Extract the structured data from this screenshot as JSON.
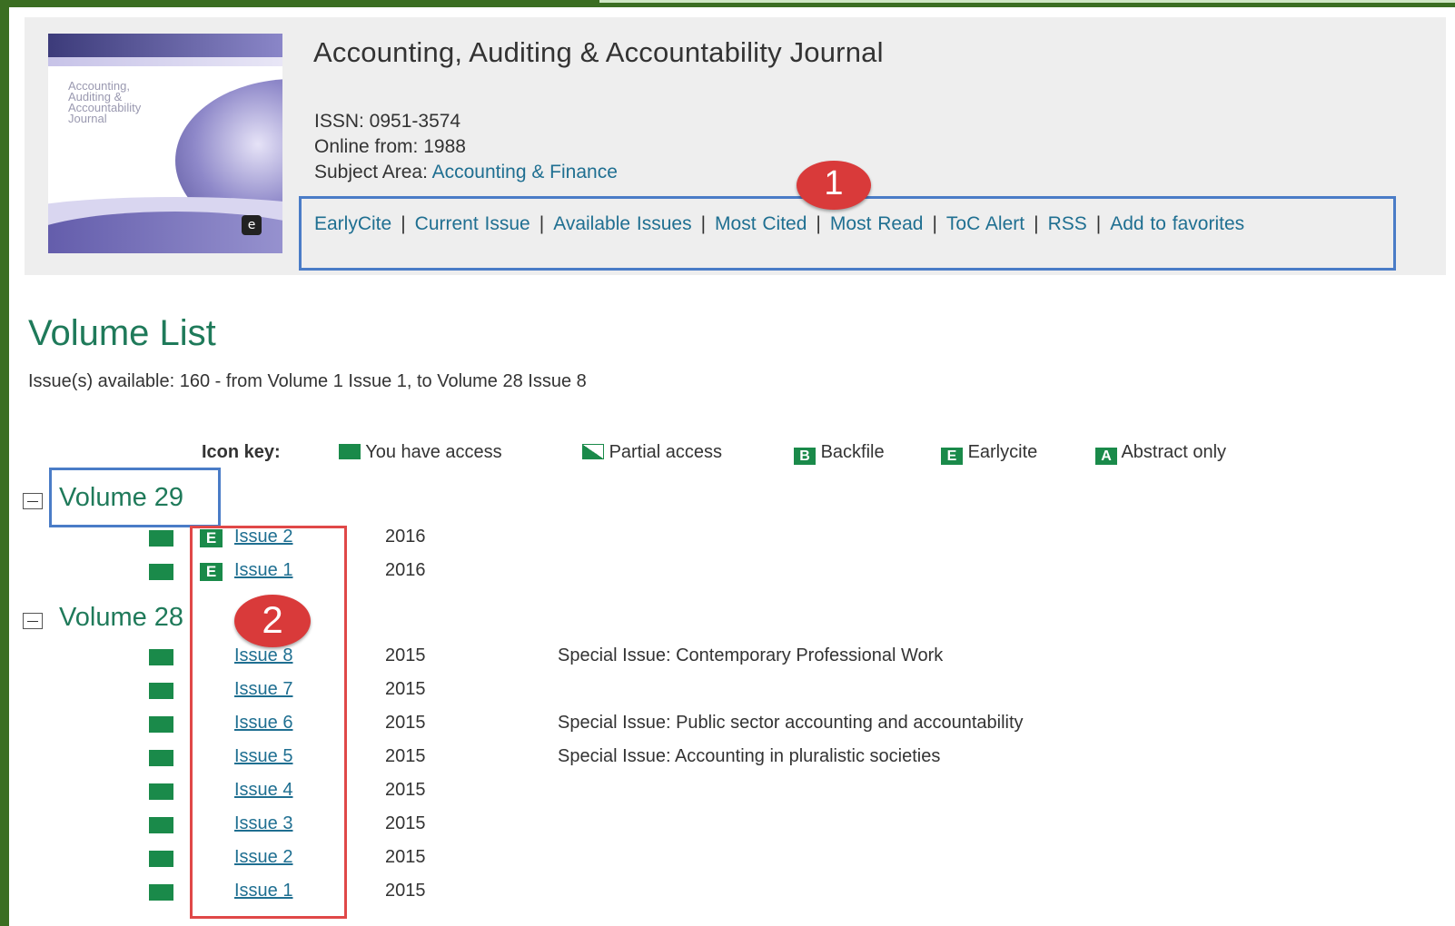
{
  "journal": {
    "title": "Accounting, Auditing & Accountability Journal",
    "issn": "ISSN: 0951-3574",
    "online_from": "Online from: 1988",
    "subject_prefix": "Subject Area: ",
    "subject_link": "Accounting & Finance",
    "cover_text": "Accounting, Auditing & Accountability Journal"
  },
  "nav": {
    "items": [
      "EarlyCite",
      "Current Issue",
      "Available Issues",
      "Most Cited",
      "Most Read",
      "ToC Alert",
      "RSS",
      "Add to favorites"
    ],
    "separator": "|"
  },
  "annotations": {
    "badge1": "1",
    "badge2": "2"
  },
  "volume_list": {
    "title": "Volume List",
    "available": "Issue(s) available: 160 - from Volume 1 Issue 1, to Volume 28 Issue 8"
  },
  "icon_key": {
    "label": "Icon key:",
    "items": [
      "You have access",
      "Partial access",
      "Backfile",
      "Earlycite",
      "Abstract only"
    ],
    "letters": {
      "backfile": "B",
      "earlycite": "E",
      "abstract": "A"
    }
  },
  "volumes": [
    {
      "name": "Volume 29",
      "issues": [
        {
          "label": "Issue 2",
          "year": "2016",
          "earlycite": "E",
          "special": ""
        },
        {
          "label": "Issue 1",
          "year": "2016",
          "earlycite": "E",
          "special": ""
        }
      ]
    },
    {
      "name": "Volume 28",
      "issues": [
        {
          "label": "Issue 8",
          "year": "2015",
          "special": "Special Issue: Contemporary Professional Work"
        },
        {
          "label": "Issue 7",
          "year": "2015",
          "special": ""
        },
        {
          "label": "Issue 6",
          "year": "2015",
          "special": "Special Issue: Public sector accounting and accountability"
        },
        {
          "label": "Issue 5",
          "year": "2015",
          "special": "Special Issue: Accounting in pluralistic societies"
        },
        {
          "label": "Issue 4",
          "year": "2015",
          "special": ""
        },
        {
          "label": "Issue 3",
          "year": "2015",
          "special": ""
        },
        {
          "label": "Issue 2",
          "year": "2015",
          "special": ""
        },
        {
          "label": "Issue 1",
          "year": "2015",
          "special": ""
        }
      ]
    }
  ],
  "colors": {
    "frame": "#3b6e22",
    "heading_green": "#1f7a5a",
    "link_blue": "#1f6f91",
    "access_green": "#1a8a4a",
    "annotation_blue": "#4a7cc7",
    "annotation_red": "#e04848",
    "badge_red": "#d93a3a"
  }
}
